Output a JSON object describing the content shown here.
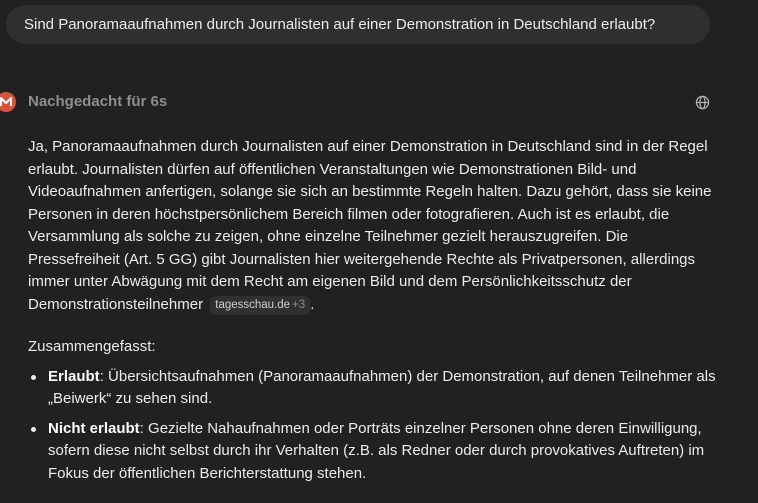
{
  "user_message": "Sind Panoramaaufnahmen durch Journalisten auf einer Demonstration in Deutschland erlaubt?",
  "assistant": {
    "thought_label": "Nachgedacht für 6s",
    "avatar_icon": "assistant-logo-icon",
    "avatar_color": "#d4553a",
    "globe_icon": "globe-icon",
    "paragraph": "Ja, Panoramaaufnahmen durch Journalisten auf einer Demonstration in Deutschland sind in der Regel erlaubt. Journalisten dürfen auf öffentlichen Veranstaltungen wie Demonstrationen Bild- und Videoaufnahmen anfertigen, solange sie sich an bestimmte Regeln halten. Dazu gehört, dass sie keine Personen in deren höchstpersönlichem Bereich filmen oder fotografieren. Auch ist es erlaubt, die Versammlung als solche zu zeigen, ohne einzelne Teilnehmer gezielt herauszugreifen. Die Pressefreiheit (Art. 5 GG) gibt Journalisten hier weitergehende Rechte als Privatpersonen, allerdings immer unter Abwägung mit dem Recht am eigenen Bild und dem Persönlichkeitsschutz der Demonstrationsteilnehmer",
    "source": {
      "domain": "tagesschau.de",
      "count": "+3"
    },
    "after_source": ".",
    "summary_heading": "Zusammengefasst:",
    "points": [
      {
        "term": "Erlaubt",
        "text": ": Übersichtsaufnahmen (Panoramaaufnahmen) der Demonstration, auf denen Teilnehmer als „Beiwerk“ zu sehen sind."
      },
      {
        "term": "Nicht erlaubt",
        "text": ": Gezielte Nahaufnahmen oder Porträts einzelner Personen ohne deren Einwilligung, sofern diese nicht selbst durch ihr Verhalten (z.B. als Redner oder durch provokatives Auftreten) im Fokus der öffentlichen Berichterstattung stehen."
      }
    ]
  }
}
